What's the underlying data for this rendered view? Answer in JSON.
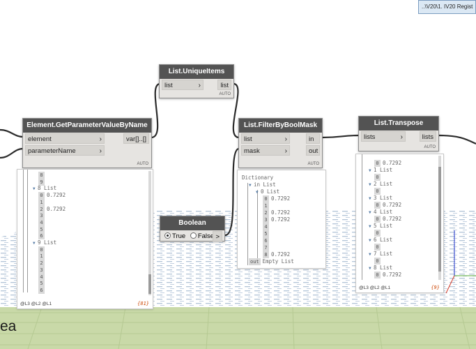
{
  "window": {
    "tab_label": "..\\V20\\1. IV20 Regist"
  },
  "ground_label": "ea",
  "nodes": {
    "unique": {
      "title": "List.UniqueItems",
      "inputs": [
        {
          "label": "list"
        }
      ],
      "output": "list",
      "lacing": "AUTO"
    },
    "getparam": {
      "title": "Element.GetParameterValueByName",
      "inputs": [
        {
          "label": "element"
        },
        {
          "label": "parameterName"
        }
      ],
      "output": "var[]..[]",
      "lacing": "AUTO"
    },
    "filter": {
      "title": "List.FilterByBoolMask",
      "inputs": [
        {
          "label": "list"
        },
        {
          "label": "mask"
        }
      ],
      "outputs": [
        "in",
        "out"
      ],
      "lacing": "AUTO"
    },
    "transpose": {
      "title": "List.Transpose",
      "inputs": [
        {
          "label": "lists"
        }
      ],
      "output": "lists",
      "lacing": "AUTO"
    },
    "boolean": {
      "title": "Boolean",
      "true_label": "True",
      "false_label": "False",
      "selected": "True",
      "output": ">"
    }
  },
  "previews": {
    "getparam": {
      "rows": [
        {
          "idx": "8",
          "text": "",
          "indent": 2
        },
        {
          "idx": "9",
          "text": "",
          "indent": 2
        },
        {
          "header": "8 List",
          "indent": 1
        },
        {
          "idx": "0",
          "text": "0.7292",
          "indent": 2
        },
        {
          "idx": "1",
          "text": "",
          "indent": 2
        },
        {
          "idx": "2",
          "text": "0.7292",
          "indent": 2
        },
        {
          "idx": "3",
          "text": "",
          "indent": 2
        },
        {
          "idx": "4",
          "text": "",
          "indent": 2
        },
        {
          "idx": "5",
          "text": "",
          "indent": 2
        },
        {
          "idx": "6",
          "text": "",
          "indent": 2
        },
        {
          "header": "9 List",
          "indent": 1
        },
        {
          "idx": "0",
          "text": "",
          "indent": 2
        },
        {
          "idx": "1",
          "text": "",
          "indent": 2
        },
        {
          "idx": "2",
          "text": "",
          "indent": 2
        },
        {
          "idx": "3",
          "text": "",
          "indent": 2
        },
        {
          "idx": "4",
          "text": "",
          "indent": 2
        },
        {
          "idx": "5",
          "text": "",
          "indent": 2
        },
        {
          "idx": "6",
          "text": "",
          "indent": 2
        }
      ],
      "footer": "@L3 @L2 @L1",
      "count": "{81}"
    },
    "filter": {
      "rows": [
        {
          "plain": "Dictionary",
          "indent": 0
        },
        {
          "header": "in List",
          "indent": 1
        },
        {
          "header": "0 List",
          "indent": 2
        },
        {
          "idx": "0",
          "text": "0.7292",
          "indent": 3
        },
        {
          "idx": "1",
          "text": "",
          "indent": 3
        },
        {
          "idx": "2",
          "text": "0.7292",
          "indent": 3
        },
        {
          "idx": "3",
          "text": "0.7292",
          "indent": 3
        },
        {
          "idx": "4",
          "text": "",
          "indent": 3
        },
        {
          "idx": "5",
          "text": "",
          "indent": 3
        },
        {
          "idx": "6",
          "text": "",
          "indent": 3
        },
        {
          "idx": "7",
          "text": "",
          "indent": 3
        },
        {
          "idx": "8",
          "text": "0.7292",
          "indent": 3
        },
        {
          "idx": "out",
          "text": "Empty List",
          "indent": 1
        }
      ]
    },
    "transpose": {
      "rows": [
        {
          "idx": "0",
          "text": "0.7292",
          "indent": 2
        },
        {
          "header": "1 List",
          "indent": 1
        },
        {
          "idx": "0",
          "text": "",
          "indent": 2
        },
        {
          "header": "2 List",
          "indent": 1
        },
        {
          "idx": "0",
          "text": "",
          "indent": 2
        },
        {
          "header": "3 List",
          "indent": 1
        },
        {
          "idx": "0",
          "text": "0.7292",
          "indent": 2
        },
        {
          "header": "4 List",
          "indent": 1
        },
        {
          "idx": "0",
          "text": "0.7292",
          "indent": 2
        },
        {
          "header": "5 List",
          "indent": 1
        },
        {
          "idx": "0",
          "text": "",
          "indent": 2
        },
        {
          "header": "6 List",
          "indent": 1
        },
        {
          "idx": "0",
          "text": "",
          "indent": 2
        },
        {
          "header": "7 List",
          "indent": 1
        },
        {
          "idx": "0",
          "text": "",
          "indent": 2
        },
        {
          "header": "8 List",
          "indent": 1
        },
        {
          "idx": "0",
          "text": "0.7292",
          "indent": 2
        }
      ],
      "footer": "@L3 @L2 @L1",
      "count": "{9}"
    }
  }
}
